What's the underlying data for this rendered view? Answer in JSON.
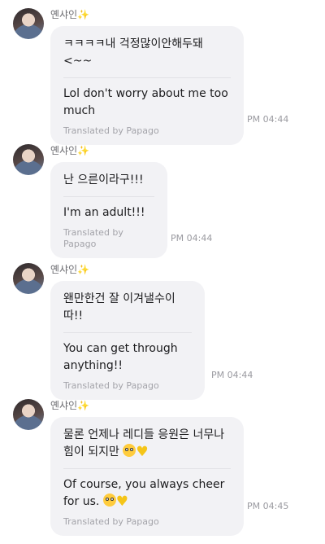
{
  "messages": [
    {
      "sender": "옌샤인",
      "sparkle": "✨",
      "original": "ㅋㅋㅋㅋ내 걱정많이안해두돼<~~",
      "translation": "Lol don't worry about me too much",
      "credit": "Translated by Papago",
      "time": "PM 04:44"
    },
    {
      "sender": "옌샤인",
      "sparkle": "✨",
      "original": "난 으른이라구!!!",
      "translation": "I'm an adult!!!",
      "credit": "Translated by Papago",
      "time": "PM 04:44"
    },
    {
      "sender": "옌샤인",
      "sparkle": "✨",
      "original": "왠만한건 잘 이겨낼수이따!!",
      "translation": "You can get through anything!!",
      "credit": "Translated by Papago",
      "time": "PM 04:44"
    },
    {
      "sender": "옌샤인",
      "sparkle": "✨",
      "original": "물론 언제나 레디들 응원은 너무나 힘이 되지만",
      "original_emojis": [
        "flushed-face",
        "yellow-heart"
      ],
      "translation": "Of course, you always cheer for us.",
      "translation_emojis": [
        "flushed-face",
        "yellow-heart"
      ],
      "credit": "Translated by Papago",
      "time": "PM 04:45"
    }
  ],
  "emoji_glyphs": {
    "yellow_heart": "♥"
  }
}
